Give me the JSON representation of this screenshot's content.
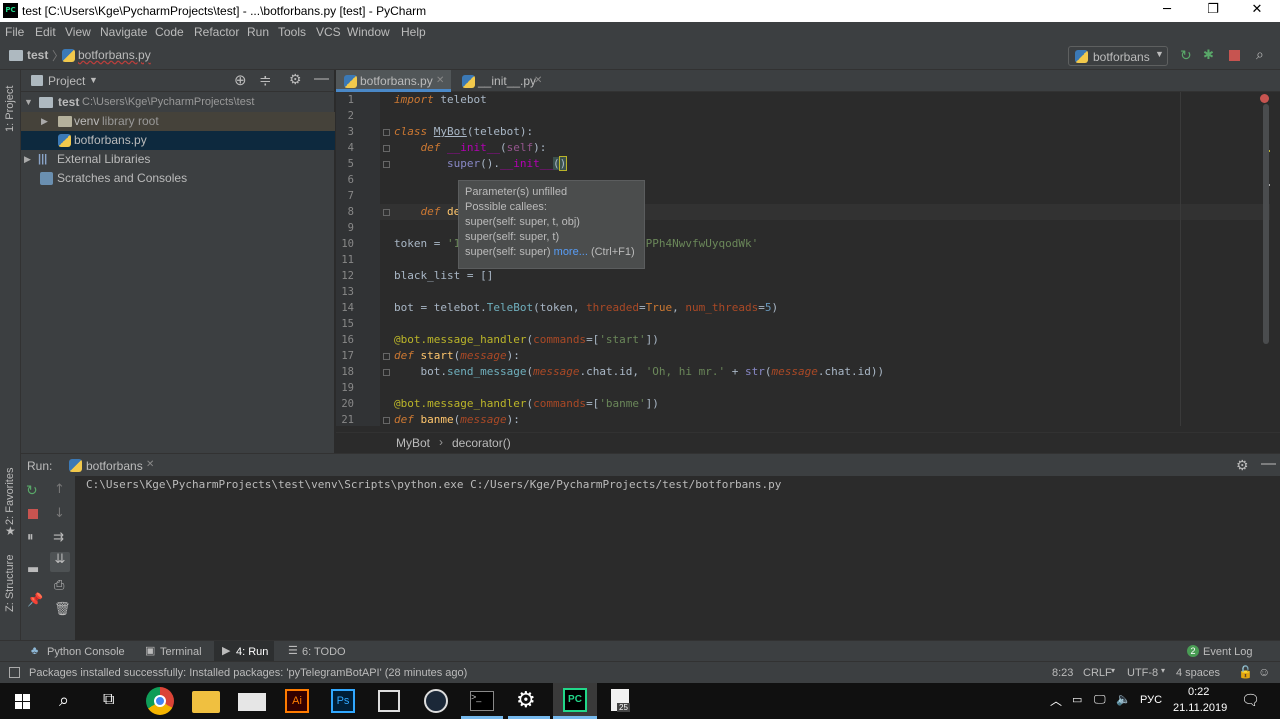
{
  "window": {
    "title": "test [C:\\Users\\Kge\\PycharmProjects\\test] - ...\\botforbans.py [test] - PyCharm",
    "logo_text": "PC"
  },
  "menu": [
    "File",
    "Edit",
    "View",
    "Navigate",
    "Code",
    "Refactor",
    "Run",
    "Tools",
    "VCS",
    "Window",
    "Help"
  ],
  "nav": {
    "project": "test",
    "file": "botforbans.py",
    "run_config": "botforbans"
  },
  "project_panel": {
    "title": "Project",
    "side_tab": "1: Project",
    "tree": {
      "root_name": "test",
      "root_path": "C:\\Users\\Kge\\PycharmProjects\\test",
      "venv_name": "venv",
      "venv_note": "library root",
      "file": "botforbans.py",
      "external": "External Libraries",
      "scratches": "Scratches and Consoles"
    }
  },
  "editor": {
    "tabs": [
      "botforbans.py",
      "__init__.py"
    ],
    "line_numbers": [
      "1",
      "2",
      "3",
      "4",
      "5",
      "6",
      "7",
      "8",
      "9",
      "10",
      "11",
      "12",
      "13",
      "14",
      "15",
      "16",
      "17",
      "18",
      "19",
      "20",
      "21"
    ],
    "breadcrumb": [
      "MyBot",
      "decorator()"
    ]
  },
  "tooltip": {
    "line1": "Parameter(s) unfilled",
    "line2": "Possible callees:",
    "line3": "super(self: super, t, obj)",
    "line4": "super(self: super, t)",
    "line5a": "super(self: super)",
    "line5b": "more...",
    "line5c": "(Ctrl+F1)"
  },
  "run": {
    "label": "Run:",
    "tab": "botforbans",
    "command": "C:\\Users\\Kge\\PycharmProjects\\test\\venv\\Scripts\\python.exe C:/Users/Kge/PycharmProjects/test/botforbans.py",
    "side_tabs": [
      "2: Favorites",
      "Z: Structure"
    ]
  },
  "bottom_tabs": [
    "Python Console",
    "Terminal",
    "4: Run",
    "6: TODO"
  ],
  "event_log": {
    "count": "2",
    "label": "Event Log"
  },
  "status": {
    "message": "Packages installed successfully: Installed packages: 'pyTelegramBotAPI' (28 minutes ago)",
    "position": "8:23",
    "line_sep": "CRLF",
    "encoding": "UTF-8",
    "indent": "4 spaces"
  },
  "taskbar": {
    "lang": "РУС",
    "time": "0:22",
    "date": "21.11.2019",
    "badge": "25"
  }
}
